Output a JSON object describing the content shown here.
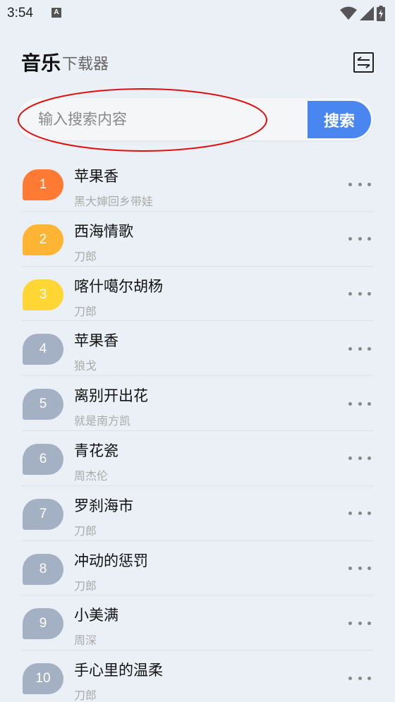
{
  "status_bar": {
    "time": "3:54",
    "notification_letter": "A"
  },
  "header": {
    "title_main": "音乐",
    "title_sub": "下载器",
    "switch_icon": "switch-arrows-icon"
  },
  "search": {
    "placeholder": "输入搜索内容",
    "button_label": "搜索"
  },
  "colors": {
    "accent": "#4a86f0",
    "rank1": "#ff7a33",
    "rank2": "#ffb433",
    "rank3": "#ffd633",
    "rank_default": "#a4b1c4",
    "annotation": "#e01010"
  },
  "songs": [
    {
      "rank": "1",
      "title": "苹果香",
      "artist": "黑大婶回乡带娃"
    },
    {
      "rank": "2",
      "title": "西海情歌",
      "artist": "刀郎"
    },
    {
      "rank": "3",
      "title": "喀什噶尔胡杨",
      "artist": "刀郎"
    },
    {
      "rank": "4",
      "title": "苹果香",
      "artist": "狼戈"
    },
    {
      "rank": "5",
      "title": "离别开出花",
      "artist": "就是南方凯"
    },
    {
      "rank": "6",
      "title": "青花瓷",
      "artist": "周杰伦"
    },
    {
      "rank": "7",
      "title": "罗刹海市",
      "artist": "刀郎"
    },
    {
      "rank": "8",
      "title": "冲动的惩罚",
      "artist": "刀郎"
    },
    {
      "rank": "9",
      "title": "小美满",
      "artist": "周深"
    },
    {
      "rank": "10",
      "title": "手心里的温柔",
      "artist": "刀郎"
    }
  ]
}
